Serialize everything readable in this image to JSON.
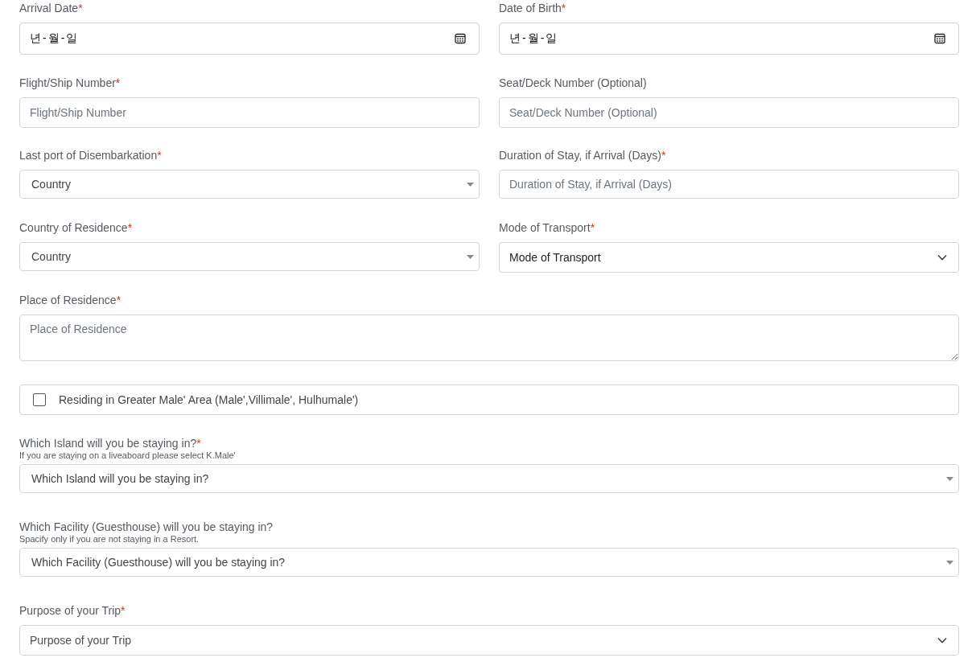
{
  "rows": [
    [
      {
        "kind": "date",
        "label": "Arrival Date",
        "required_mark": "*",
        "value": "년-월-일"
      },
      {
        "kind": "date",
        "label": "Date of Birth",
        "required_mark": "*",
        "value": "년-월-일"
      }
    ],
    [
      {
        "kind": "text",
        "label": "Flight/Ship Number",
        "required_mark": "*",
        "placeholder": "Flight/Ship Number"
      },
      {
        "kind": "text",
        "label": "Seat/Deck Number (Optional)",
        "placeholder": "Seat/Deck Number (Optional)"
      }
    ],
    [
      {
        "kind": "dropdown",
        "label": "Last port of Disembarkation",
        "required_mark": "*",
        "value": "Country"
      },
      {
        "kind": "text",
        "label": "Duration of Stay, if Arrival (Days)",
        "required_mark": "*",
        "placeholder": "Duration of Stay, if Arrival (Days)"
      }
    ],
    [
      {
        "kind": "dropdown",
        "label": "Country of Residence",
        "required_mark": "*",
        "value": "Country"
      },
      {
        "kind": "select",
        "label": "Mode of Transport",
        "required_mark": "*",
        "value": "Mode of Transport"
      }
    ],
    [
      {
        "kind": "textarea",
        "label": "Place of Residence",
        "required_mark": "*",
        "placeholder": "Place of Residence"
      }
    ],
    [
      {
        "kind": "checkbox",
        "label": "Residing in Greater Male' Area (Male',Villimale', Hulhumale')",
        "checked": false
      }
    ],
    [
      {
        "kind": "dropdown",
        "label": "Which Island will you be staying in?",
        "required_mark": "*",
        "hint": "If you are staying on a liveaboard please select K.Male'",
        "value": "Which Island will you be staying in?"
      }
    ],
    [
      {
        "kind": "dropdown",
        "label": "Which Facility (Guesthouse) will you be staying in?",
        "hint": "Spacify only if you are not staying in a Resort.",
        "value": "Which Facility (Guesthouse) will you be staying in?"
      }
    ],
    [
      {
        "kind": "select",
        "label": "Purpose of your Trip",
        "required_mark": "*",
        "value": "Purpose of your Trip"
      }
    ]
  ]
}
